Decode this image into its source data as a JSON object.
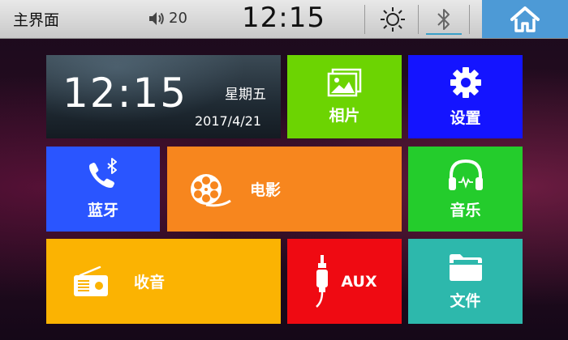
{
  "header": {
    "title": "主界面",
    "volume": "20",
    "time": "12:15"
  },
  "clock_widget": {
    "time": "12:15",
    "weekday": "星期五",
    "date": "2017/4/21"
  },
  "tiles": {
    "photos": {
      "label": "相片",
      "color": "#6cd402"
    },
    "settings": {
      "label": "设置",
      "color": "#1414ff"
    },
    "bluetooth": {
      "label": "蓝牙",
      "color": "#2a55ff"
    },
    "movie": {
      "label": "电影",
      "color": "#f7861e"
    },
    "music": {
      "label": "音乐",
      "color": "#24cc2c"
    },
    "radio": {
      "label": "收音",
      "color": "#fbb302"
    },
    "aux": {
      "label": "AUX",
      "color": "#ef0a12"
    },
    "files": {
      "label": "文件",
      "color": "#2db8ac"
    }
  },
  "icons": [
    "volume-icon",
    "brightness-icon",
    "bluetooth-icon",
    "home-icon",
    "photo-icon",
    "gear-icon",
    "bluetooth-phone-icon",
    "film-reel-icon",
    "headphones-icon",
    "radio-icon",
    "aux-cable-icon",
    "folder-icon"
  ]
}
